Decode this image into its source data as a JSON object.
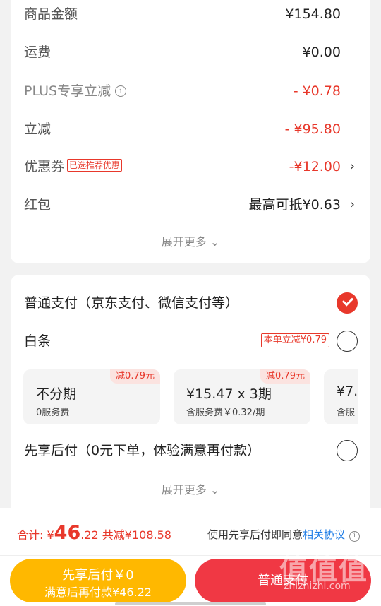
{
  "summary": {
    "rows": [
      {
        "label": "商品金额",
        "value": "¥154.80"
      },
      {
        "label": "运费",
        "value": "¥0.00"
      },
      {
        "label": "PLUS专享立减",
        "value": "- ¥0.78"
      },
      {
        "label": "立减",
        "value": "- ¥95.80"
      },
      {
        "label": "优惠券",
        "tag": "已选推荐优惠",
        "value": "-¥12.00"
      },
      {
        "label": "红包",
        "value": "最高可抵¥0.63"
      }
    ],
    "expand_label": "展开更多"
  },
  "payment": {
    "normal_pay_label": "普通支付（京东支付、微信支付等）",
    "baitiao_label": "白条",
    "baitiao_tag": "本单立减¥0.79",
    "installments": [
      {
        "badge": "减0.79元",
        "main": "不分期",
        "sub": "0服务费"
      },
      {
        "badge": "减0.79元",
        "main": "¥15.47 x 3期",
        "sub": "含服务费￥0.32/期"
      },
      {
        "badge": "",
        "main": "¥7.",
        "sub": "含服"
      }
    ],
    "pay_later_label": "先享后付（0元下单，体验满意再付款）",
    "expand_label": "展开更多"
  },
  "bottom": {
    "total_prefix": "合计: ¥",
    "total_int": "46",
    "total_dec": ".22",
    "discount_text": "共减¥108.58",
    "agree_text": "使用先享后付即同意",
    "agree_link": "相关协议",
    "pay_later_button": "先享后付￥0",
    "pay_later_sub": "满意后再付款¥46.22",
    "normal_pay_button": "普通支付"
  },
  "watermark": {
    "logo": "值值值",
    "site": "zhizhizhi.com"
  },
  "colors": {
    "accent_red": "#e8382b",
    "yellow": "#ffb800",
    "button_red": "#f03844",
    "link_blue": "#1d7ce6"
  }
}
